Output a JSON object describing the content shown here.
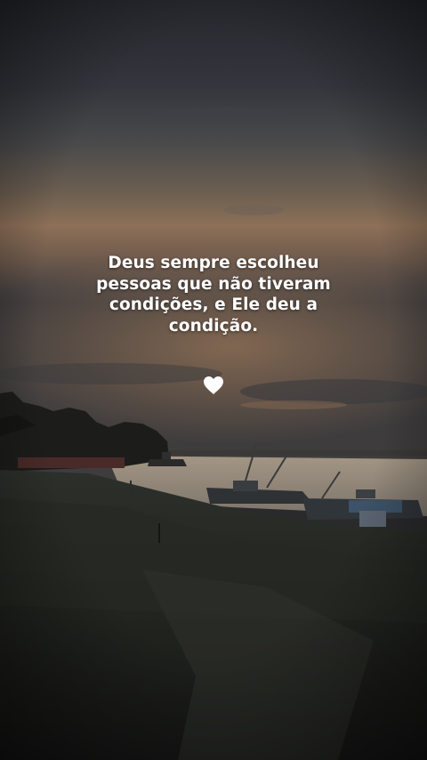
{
  "quote": {
    "line1": "Deus sempre escolheu",
    "line2": "pessoas que não tiveram",
    "line3": "condições, e Ele deu a",
    "line4": "condição."
  },
  "heart": {
    "icon": "white-heart-icon",
    "color": "#ffffff"
  },
  "colors": {
    "sky_top": "#2b2c33",
    "sky_glow": "#8a6a4e",
    "water": "#9b9184",
    "ground": "#1f211d"
  }
}
